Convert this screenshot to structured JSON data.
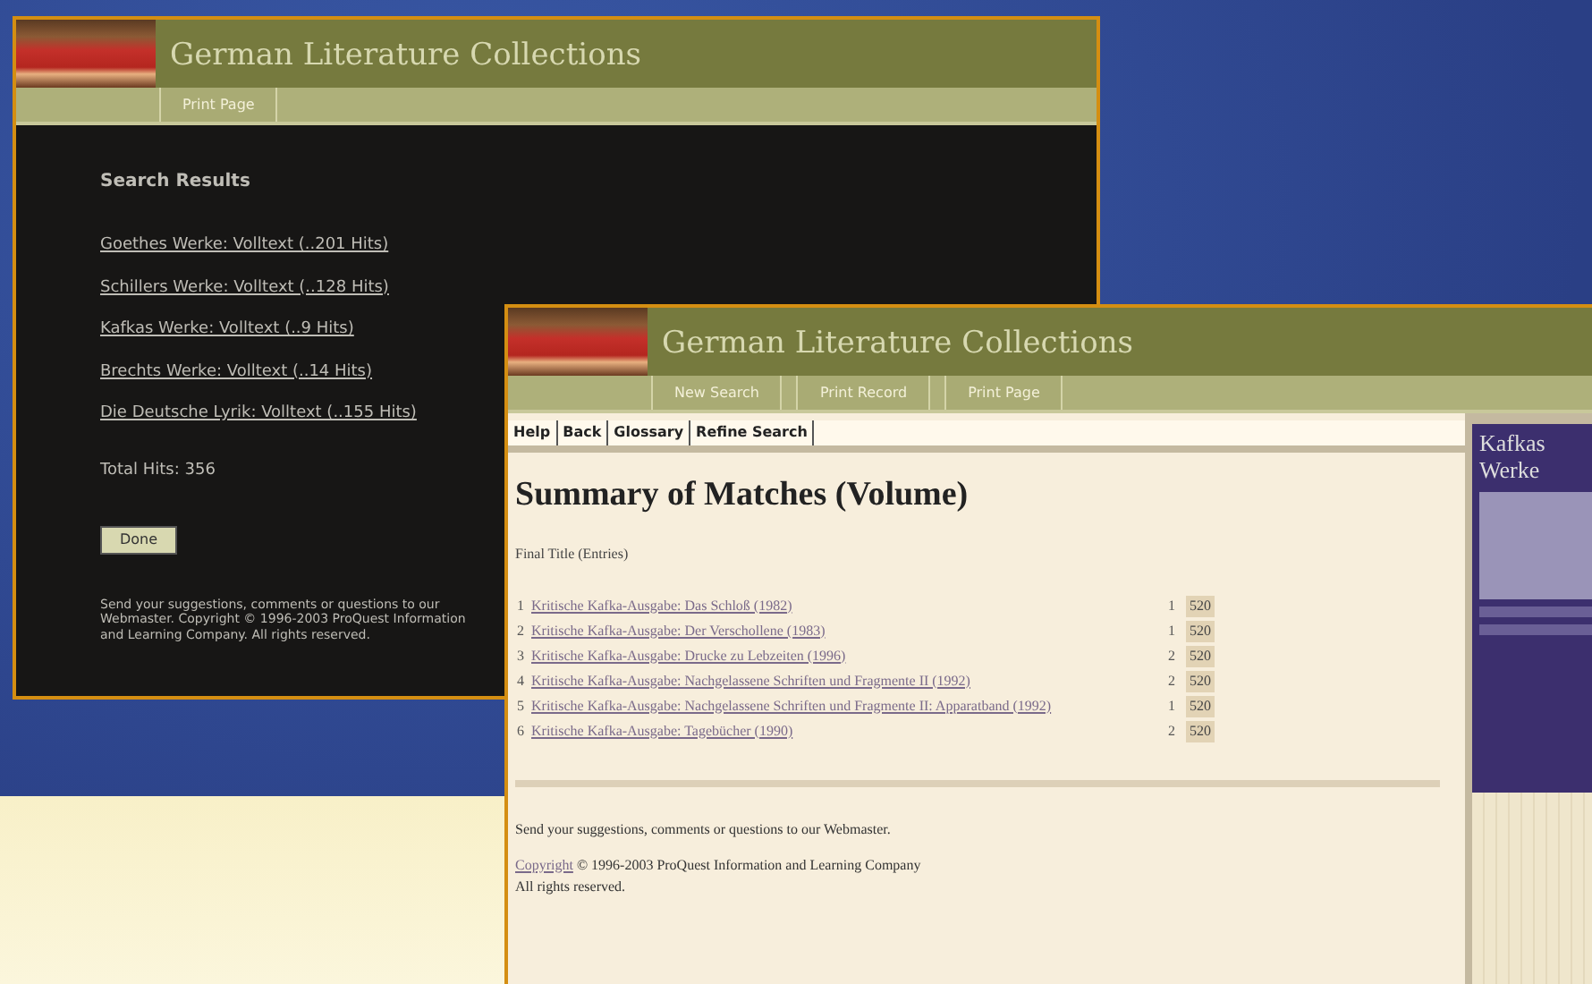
{
  "windows": [
    {
      "title": "German Literature Collections",
      "tabs": [
        {
          "label": "Print Page",
          "selected": false
        }
      ],
      "heading": "Search Results",
      "results": [
        "Goethes Werke: Volltext (..201 Hits)",
        "Schillers Werke: Volltext (..128 Hits)",
        "Kafkas Werke: Volltext (..9 Hits)",
        "Brechts Werke: Volltext (..14 Hits)",
        "Die Deutsche Lyrik: Volltext (..155 Hits)"
      ],
      "total": "Total Hits: 356",
      "button": "Done",
      "footer": "Send your suggestions, comments or questions to our Webmaster. Copyright © 1996-2003 ProQuest Information and Learning Company. All rights reserved."
    },
    {
      "title": "German Literature Collections",
      "tabs": [
        {
          "label": "New Search",
          "selected": false
        },
        {
          "label": "Print Record",
          "selected": false
        },
        {
          "label": "Print Page",
          "selected": false
        }
      ],
      "links": [
        "Help",
        "Back",
        "Glossary",
        "Refine Search"
      ],
      "heading": "Summary of Matches (Volume)",
      "subheading": "Final Title (Entries)",
      "matches": [
        {
          "num": "1",
          "title": "Kritische Kafka-Ausgabe: Das Schloß (1982)",
          "count": "1",
          "hits": "520"
        },
        {
          "num": "2",
          "title": "Kritische Kafka-Ausgabe: Der Verschollene (1983)",
          "count": "1",
          "hits": "520"
        },
        {
          "num": "3",
          "title": "Kritische Kafka-Ausgabe: Drucke zu Lebzeiten (1996)",
          "count": "2",
          "hits": "520"
        },
        {
          "num": "4",
          "title": "Kritische Kafka-Ausgabe: Nachgelassene Schriften und Fragmente II (1992)",
          "count": "2",
          "hits": "520"
        },
        {
          "num": "5",
          "title": "Kritische Kafka-Ausgabe: Nachgelassene Schriften und Fragmente II: Apparatband (1992)",
          "count": "1",
          "hits": "520"
        },
        {
          "num": "6",
          "title": "Kritische Kafka-Ausgabe: Tagebücher (1990)",
          "count": "2",
          "hits": "520"
        }
      ],
      "feedback": "Send your suggestions, comments or questions to our Webmaster.",
      "copyright_link": "Copyright",
      "copyright": "© 1996-2003 ProQuest Information and Learning Company",
      "rights": "All rights reserved.",
      "sidebar": {
        "title": "Kafkas Werke"
      }
    }
  ]
}
